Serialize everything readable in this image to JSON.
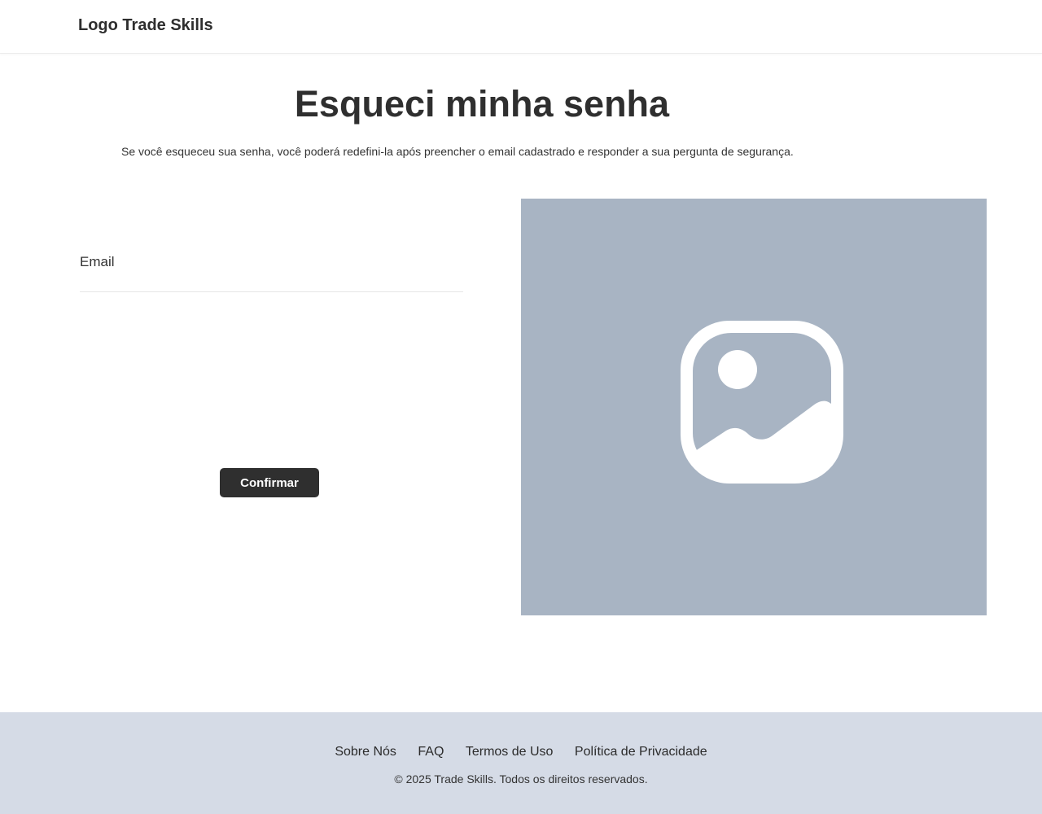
{
  "header": {
    "logo": "Logo Trade Skills"
  },
  "main": {
    "title": "Esqueci minha senha",
    "description": "Se você esqueceu sua senha, você poderá redefini-la após preencher o email cadastrado e responder a sua pergunta de segurança.",
    "form": {
      "email_label": "Email",
      "email_value": "",
      "email_placeholder": "",
      "confirm_label": "Confirmar"
    },
    "image": {
      "icon": "image-placeholder-icon",
      "background_color": "#a8b4c3"
    }
  },
  "footer": {
    "links": [
      "Sobre Nós",
      "FAQ",
      "Termos de Uso",
      "Política de Privacidade"
    ],
    "copyright": "© 2025 Trade Skills. Todos os direitos reservados.",
    "background_color": "#d5dbe6"
  }
}
